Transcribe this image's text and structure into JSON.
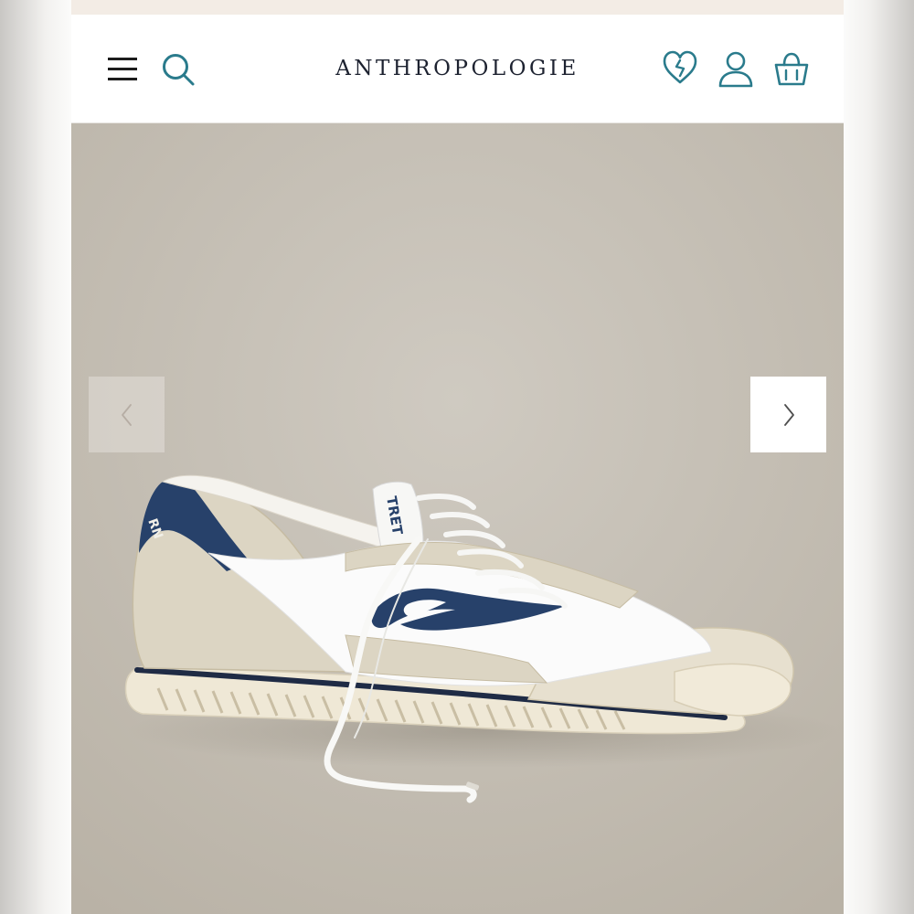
{
  "header": {
    "brand": "ANTHROPOLOGIE",
    "menu_icon": "hamburger-menu-icon",
    "search_icon": "search-icon",
    "wishlist_icon": "heart-icon",
    "account_icon": "user-icon",
    "bag_icon": "shopping-bag-icon",
    "icon_color": "#2a7b8c"
  },
  "carousel": {
    "prev_icon": "chevron-left-icon",
    "next_icon": "chevron-right-icon",
    "prev_enabled": false,
    "next_enabled": true,
    "shoe_tongue_text": "TRET",
    "shoe_heel_text": "RN"
  },
  "colors": {
    "navy_accent": "#27416a",
    "suede": "#dcd5c3",
    "background": "#c5bfb5"
  }
}
